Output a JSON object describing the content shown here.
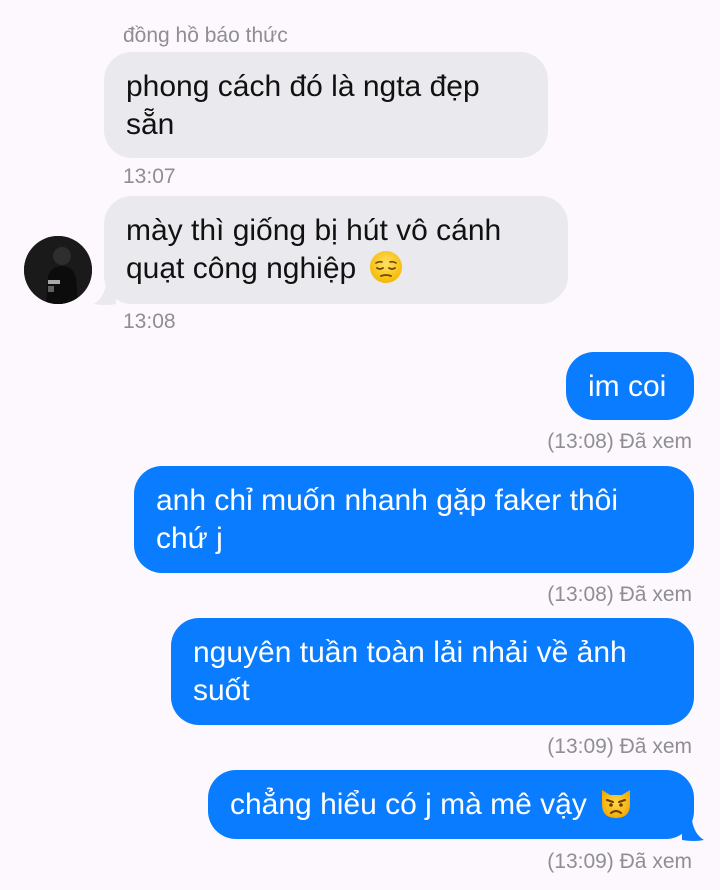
{
  "chat": {
    "sender_name": "đồng hồ báo thức",
    "messages": [
      {
        "direction": "incoming",
        "lines": [
          "phong cách đó là ngta đẹp",
          "sẵn"
        ],
        "time": "13:07"
      },
      {
        "direction": "incoming",
        "lines": [
          "mày thì giống bị hút vô cánh",
          "quạt công nghiệp"
        ],
        "emoji": "pensive-face-emoji",
        "time": "13:08"
      },
      {
        "direction": "outgoing",
        "lines": [
          "im coi"
        ],
        "status": "(13:08) Đã xem"
      },
      {
        "direction": "outgoing",
        "lines": [
          "anh chỉ muốn nhanh gặp faker thôi",
          "chứ j"
        ],
        "status": "(13:08) Đã xem"
      },
      {
        "direction": "outgoing",
        "lines": [
          "nguyên tuần toàn lải nhải về ảnh",
          "suốt"
        ],
        "status": "(13:09) Đã xem"
      },
      {
        "direction": "outgoing",
        "lines": [
          "chẳng hiểu có j mà mê vậy"
        ],
        "emoji": "pouting-cat-emoji",
        "status": "(13:09) Đã xem"
      }
    ]
  },
  "colors": {
    "background": "#fdf8fd",
    "incoming_bubble": "#e9e9ee",
    "outgoing_bubble": "#0a7cff",
    "meta_text": "#8e8e93"
  }
}
